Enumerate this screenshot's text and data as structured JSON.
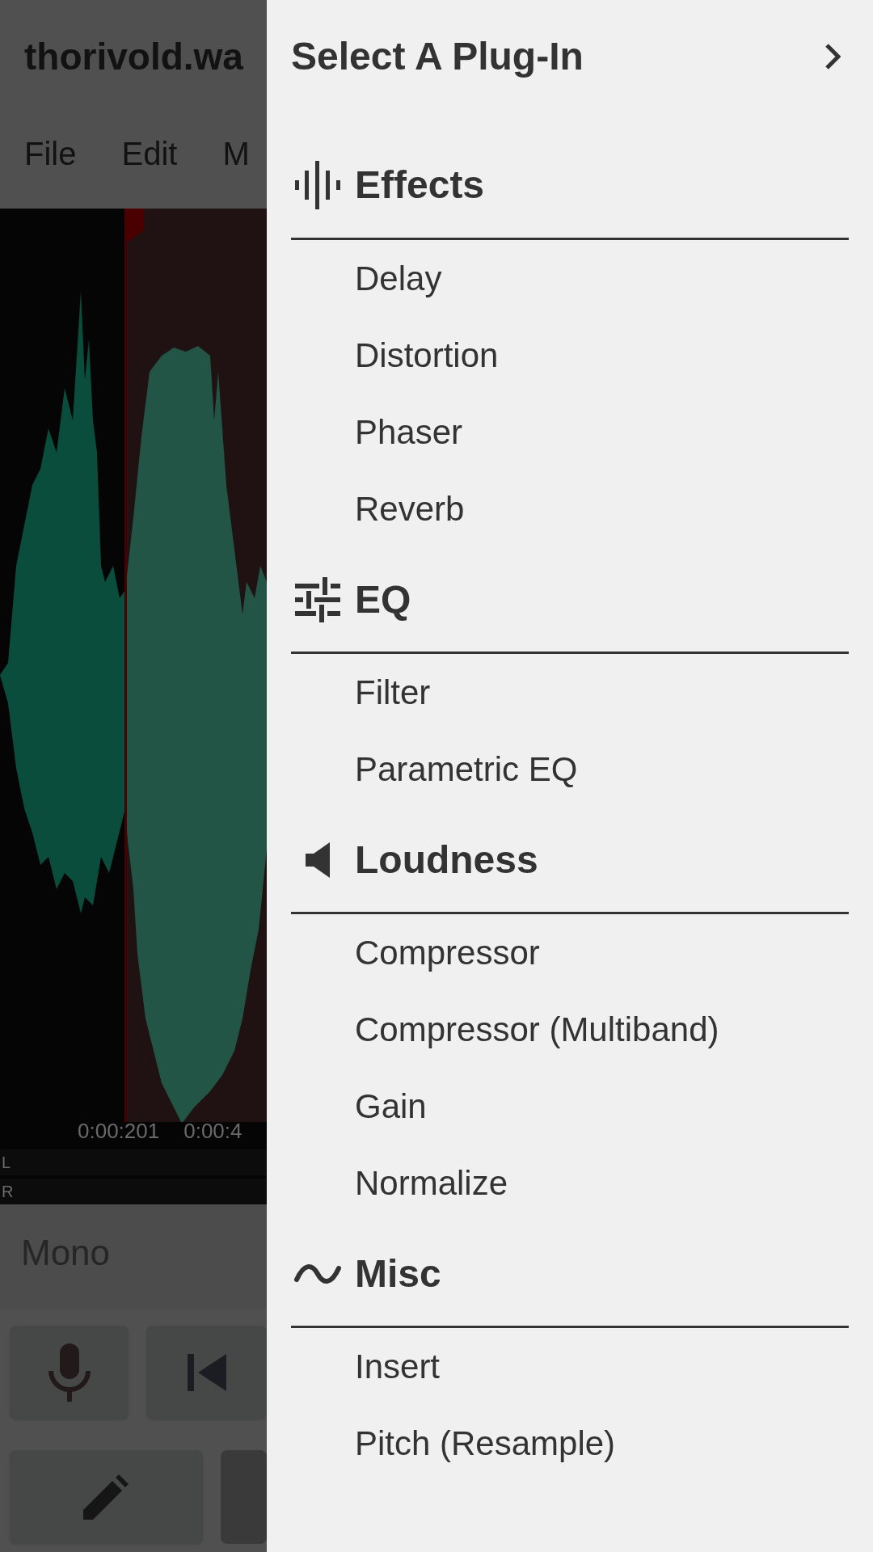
{
  "background_app": {
    "title": "thorivold.wa",
    "menu": [
      "File",
      "Edit",
      "M"
    ],
    "time_labels": [
      "0:00:201",
      "0:00:4"
    ],
    "channels": [
      "L",
      "R"
    ],
    "mode": "Mono"
  },
  "drawer": {
    "title": "Select A Plug-In",
    "sections": [
      {
        "kind": "effects",
        "title": "Effects",
        "items": [
          "Delay",
          "Distortion",
          "Phaser",
          "Reverb"
        ]
      },
      {
        "kind": "eq",
        "title": "EQ",
        "items": [
          "Filter",
          "Parametric EQ"
        ]
      },
      {
        "kind": "loudness",
        "title": "Loudness",
        "items": [
          "Compressor",
          "Compressor (Multiband)",
          "Gain",
          "Normalize"
        ]
      },
      {
        "kind": "misc",
        "title": "Misc",
        "items": [
          "Insert",
          "Pitch (Resample)"
        ]
      }
    ]
  }
}
